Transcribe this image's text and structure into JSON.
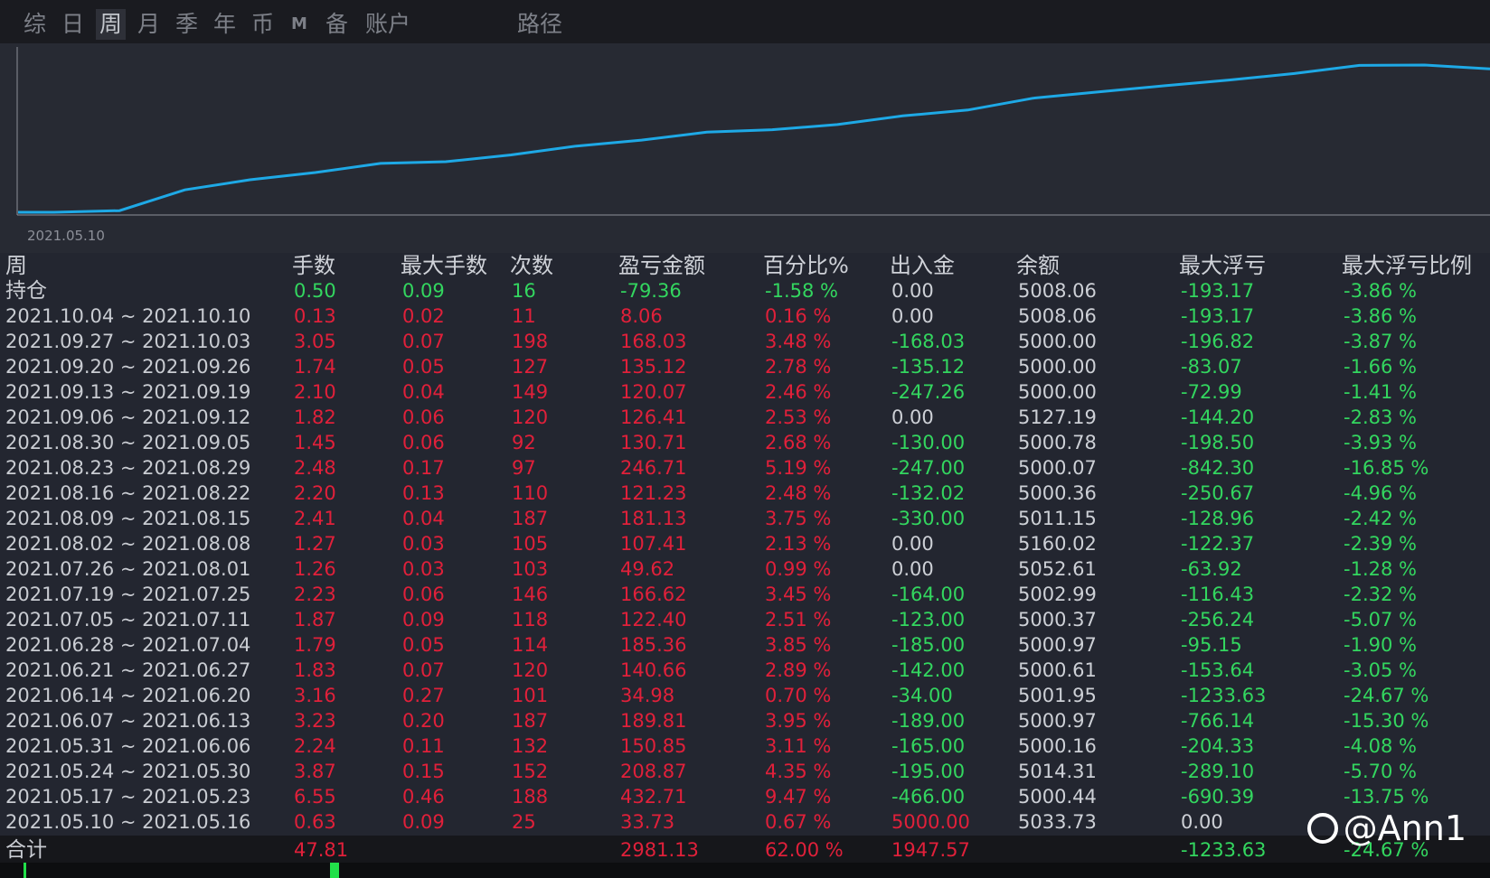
{
  "tabs": [
    {
      "label": "综",
      "active": false
    },
    {
      "label": "日",
      "active": false
    },
    {
      "label": "周",
      "active": true
    },
    {
      "label": "月",
      "active": false
    },
    {
      "label": "季",
      "active": false
    },
    {
      "label": "年",
      "active": false
    },
    {
      "label": "币",
      "active": false
    },
    {
      "label": "M",
      "active": false
    },
    {
      "label": "备",
      "active": false
    },
    {
      "label": "账户",
      "active": false
    },
    {
      "label": "路径",
      "active": false
    }
  ],
  "chart": {
    "start_label": "2021.05.10",
    "line_color": "#1ea9e6"
  },
  "colors": {
    "red": "#e0203a",
    "green": "#33d65f",
    "white": "#cdd0d6",
    "bg": "#232630"
  },
  "table": {
    "headers": [
      "周",
      "手数",
      "最大手数",
      "次数",
      "盈亏金额",
      "百分比%",
      "出入金",
      "余额",
      "最大浮亏",
      "最大浮亏比例"
    ],
    "holding": {
      "label": "持仓",
      "lots": "0.50",
      "max_lots": "0.09",
      "count": "16",
      "pnl": "-79.36",
      "pct": "-1.58 %",
      "flow": "0.00",
      "balance": "5008.06",
      "max_dd": "-193.17",
      "max_dd_pct": "-3.86 %"
    },
    "rows": [
      {
        "week": "2021.10.04 ~ 2021.10.10",
        "lots": "0.13",
        "max_lots": "0.02",
        "count": "11",
        "pnl": "8.06",
        "pct": "0.16 %",
        "flow": "0.00",
        "balance": "5008.06",
        "max_dd": "-193.17",
        "max_dd_pct": "-3.86 %"
      },
      {
        "week": "2021.09.27 ~ 2021.10.03",
        "lots": "3.05",
        "max_lots": "0.07",
        "count": "198",
        "pnl": "168.03",
        "pct": "3.48 %",
        "flow": "-168.03",
        "balance": "5000.00",
        "max_dd": "-196.82",
        "max_dd_pct": "-3.87 %"
      },
      {
        "week": "2021.09.20 ~ 2021.09.26",
        "lots": "1.74",
        "max_lots": "0.05",
        "count": "127",
        "pnl": "135.12",
        "pct": "2.78 %",
        "flow": "-135.12",
        "balance": "5000.00",
        "max_dd": "-83.07",
        "max_dd_pct": "-1.66 %"
      },
      {
        "week": "2021.09.13 ~ 2021.09.19",
        "lots": "2.10",
        "max_lots": "0.04",
        "count": "149",
        "pnl": "120.07",
        "pct": "2.46 %",
        "flow": "-247.26",
        "balance": "5000.00",
        "max_dd": "-72.99",
        "max_dd_pct": "-1.41 %"
      },
      {
        "week": "2021.09.06 ~ 2021.09.12",
        "lots": "1.82",
        "max_lots": "0.06",
        "count": "120",
        "pnl": "126.41",
        "pct": "2.53 %",
        "flow": "0.00",
        "balance": "5127.19",
        "max_dd": "-144.20",
        "max_dd_pct": "-2.83 %"
      },
      {
        "week": "2021.08.30 ~ 2021.09.05",
        "lots": "1.45",
        "max_lots": "0.06",
        "count": "92",
        "pnl": "130.71",
        "pct": "2.68 %",
        "flow": "-130.00",
        "balance": "5000.78",
        "max_dd": "-198.50",
        "max_dd_pct": "-3.93 %"
      },
      {
        "week": "2021.08.23 ~ 2021.08.29",
        "lots": "2.48",
        "max_lots": "0.17",
        "count": "97",
        "pnl": "246.71",
        "pct": "5.19 %",
        "flow": "-247.00",
        "balance": "5000.07",
        "max_dd": "-842.30",
        "max_dd_pct": "-16.85 %"
      },
      {
        "week": "2021.08.16 ~ 2021.08.22",
        "lots": "2.20",
        "max_lots": "0.13",
        "count": "110",
        "pnl": "121.23",
        "pct": "2.48 %",
        "flow": "-132.02",
        "balance": "5000.36",
        "max_dd": "-250.67",
        "max_dd_pct": "-4.96 %"
      },
      {
        "week": "2021.08.09 ~ 2021.08.15",
        "lots": "2.41",
        "max_lots": "0.04",
        "count": "187",
        "pnl": "181.13",
        "pct": "3.75 %",
        "flow": "-330.00",
        "balance": "5011.15",
        "max_dd": "-128.96",
        "max_dd_pct": "-2.42 %"
      },
      {
        "week": "2021.08.02 ~ 2021.08.08",
        "lots": "1.27",
        "max_lots": "0.03",
        "count": "105",
        "pnl": "107.41",
        "pct": "2.13 %",
        "flow": "0.00",
        "balance": "5160.02",
        "max_dd": "-122.37",
        "max_dd_pct": "-2.39 %"
      },
      {
        "week": "2021.07.26 ~ 2021.08.01",
        "lots": "1.26",
        "max_lots": "0.03",
        "count": "103",
        "pnl": "49.62",
        "pct": "0.99 %",
        "flow": "0.00",
        "balance": "5052.61",
        "max_dd": "-63.92",
        "max_dd_pct": "-1.28 %"
      },
      {
        "week": "2021.07.19 ~ 2021.07.25",
        "lots": "2.23",
        "max_lots": "0.06",
        "count": "146",
        "pnl": "166.62",
        "pct": "3.45 %",
        "flow": "-164.00",
        "balance": "5002.99",
        "max_dd": "-116.43",
        "max_dd_pct": "-2.32 %"
      },
      {
        "week": "2021.07.05 ~ 2021.07.11",
        "lots": "1.87",
        "max_lots": "0.09",
        "count": "118",
        "pnl": "122.40",
        "pct": "2.51 %",
        "flow": "-123.00",
        "balance": "5000.37",
        "max_dd": "-256.24",
        "max_dd_pct": "-5.07 %"
      },
      {
        "week": "2021.06.28 ~ 2021.07.04",
        "lots": "1.79",
        "max_lots": "0.05",
        "count": "114",
        "pnl": "185.36",
        "pct": "3.85 %",
        "flow": "-185.00",
        "balance": "5000.97",
        "max_dd": "-95.15",
        "max_dd_pct": "-1.90 %"
      },
      {
        "week": "2021.06.21 ~ 2021.06.27",
        "lots": "1.83",
        "max_lots": "0.07",
        "count": "120",
        "pnl": "140.66",
        "pct": "2.89 %",
        "flow": "-142.00",
        "balance": "5000.61",
        "max_dd": "-153.64",
        "max_dd_pct": "-3.05 %"
      },
      {
        "week": "2021.06.14 ~ 2021.06.20",
        "lots": "3.16",
        "max_lots": "0.27",
        "count": "101",
        "pnl": "34.98",
        "pct": "0.70 %",
        "flow": "-34.00",
        "balance": "5001.95",
        "max_dd": "-1233.63",
        "max_dd_pct": "-24.67 %"
      },
      {
        "week": "2021.06.07 ~ 2021.06.13",
        "lots": "3.23",
        "max_lots": "0.20",
        "count": "187",
        "pnl": "189.81",
        "pct": "3.95 %",
        "flow": "-189.00",
        "balance": "5000.97",
        "max_dd": "-766.14",
        "max_dd_pct": "-15.30 %"
      },
      {
        "week": "2021.05.31 ~ 2021.06.06",
        "lots": "2.24",
        "max_lots": "0.11",
        "count": "132",
        "pnl": "150.85",
        "pct": "3.11 %",
        "flow": "-165.00",
        "balance": "5000.16",
        "max_dd": "-204.33",
        "max_dd_pct": "-4.08 %"
      },
      {
        "week": "2021.05.24 ~ 2021.05.30",
        "lots": "3.87",
        "max_lots": "0.15",
        "count": "152",
        "pnl": "208.87",
        "pct": "4.35 %",
        "flow": "-195.00",
        "balance": "5014.31",
        "max_dd": "-289.10",
        "max_dd_pct": "-5.70 %"
      },
      {
        "week": "2021.05.17 ~ 2021.05.23",
        "lots": "6.55",
        "max_lots": "0.46",
        "count": "188",
        "pnl": "432.71",
        "pct": "9.47 %",
        "flow": "-466.00",
        "balance": "5000.44",
        "max_dd": "-690.39",
        "max_dd_pct": "-13.75 %"
      },
      {
        "week": "2021.05.10 ~ 2021.05.16",
        "lots": "0.63",
        "max_lots": "0.09",
        "count": "25",
        "pnl": "33.73",
        "pct": "0.67 %",
        "flow": "5000.00",
        "balance": "5033.73",
        "max_dd": "0.00",
        "max_dd_pct": ""
      }
    ],
    "total": {
      "label": "合计",
      "lots": "47.81",
      "pnl": "2981.13",
      "pct": "62.00 %",
      "flow": "1947.57",
      "max_dd": "-1233.63",
      "max_dd_pct": "-24.67 %"
    }
  },
  "watermark": {
    "text": "@Ann1"
  }
}
